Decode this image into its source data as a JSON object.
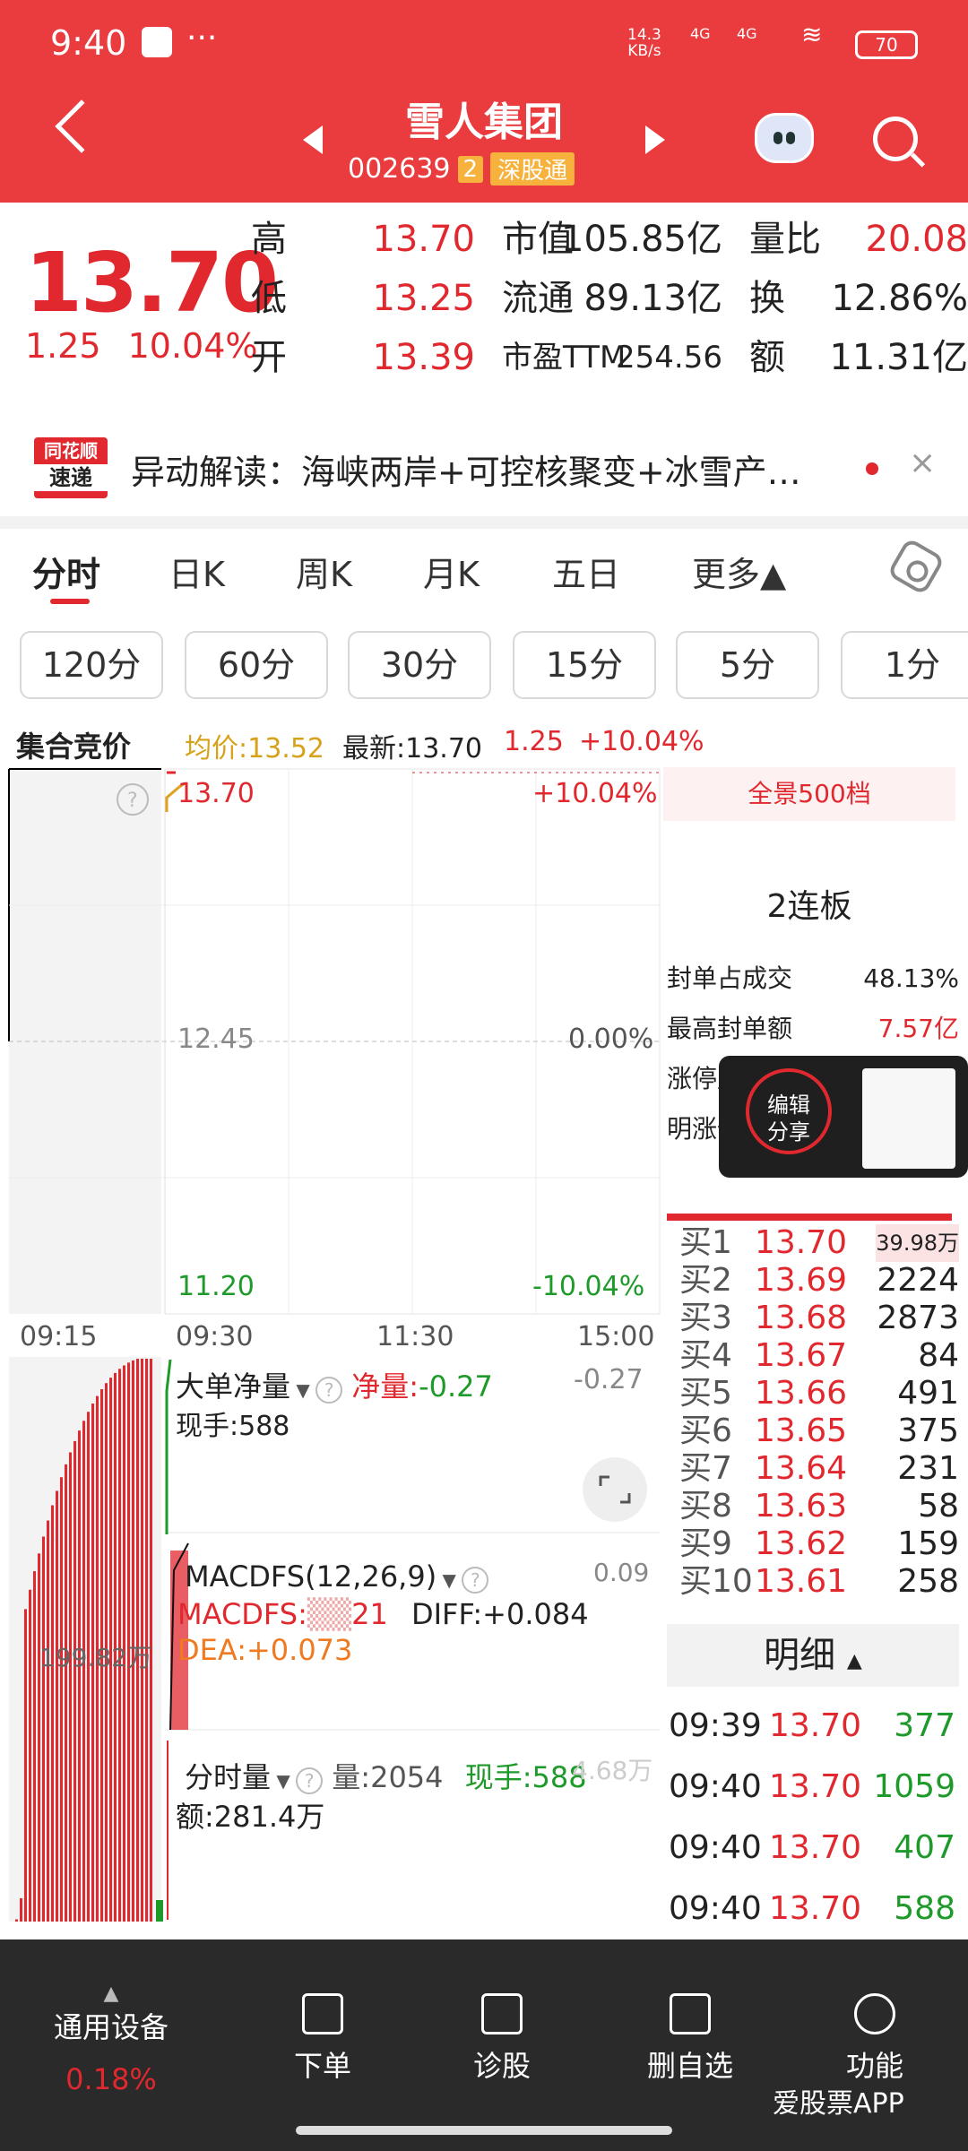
{
  "status": {
    "time": "9:40",
    "dots": "···",
    "netspeed_value": "14.3",
    "netspeed_unit": "KB/s",
    "signal1": "4G",
    "signal2": "4G",
    "battery": "70"
  },
  "header": {
    "title": "雪人集团",
    "code": "002639",
    "badge": "2",
    "market": "深股通"
  },
  "quote": {
    "price": "13.70",
    "change": "1.25",
    "change_pct": "10.04%",
    "col1": [
      {
        "label": "高",
        "value": "13.70"
      },
      {
        "label": "低",
        "value": "13.25"
      },
      {
        "label": "开",
        "value": "13.39"
      }
    ],
    "col2": [
      {
        "label": "市值",
        "value": "105.85亿"
      },
      {
        "label": "流通",
        "value": "89.13亿"
      },
      {
        "label": "市盈TTM",
        "value": "254.56"
      }
    ],
    "col3": [
      {
        "label": "量比",
        "value": "20.08"
      },
      {
        "label": "换",
        "value": "12.86%"
      },
      {
        "label": "额",
        "value": "11.31亿"
      }
    ]
  },
  "news": {
    "logo_top": "同花顺",
    "logo_bottom": "速递",
    "text": "异动解读：海峡两岸+可控核聚变+冰雪产…",
    "close": "×"
  },
  "tabs": [
    "分时",
    "日K",
    "周K",
    "月K",
    "五日",
    "更多▲"
  ],
  "periods": [
    "120分",
    "60分",
    "30分",
    "15分",
    "5分",
    "1分"
  ],
  "chartinfo": {
    "auction": "集合竞价",
    "avg": "均价:13.52",
    "latest": "最新:13.70",
    "chg": "1.25",
    "pct": "+10.04%"
  },
  "chart": {
    "high_price": "13.70",
    "mid_price": "12.45",
    "low_price": "11.20",
    "high_pct": "+10.04%",
    "mid_pct": "0.00%",
    "low_pct": "-10.04%",
    "times": [
      "09:15",
      "09:30",
      "11:30",
      "15:00"
    ],
    "auction_vol": "199.82万",
    "bigorder": {
      "title": "大单净量",
      "net_label": "净量:",
      "net_value": "-0.27",
      "right": "-0.27",
      "hand": "现手:588"
    },
    "macd": {
      "title": "MACDFS(12,26,9)",
      "right": "0.09",
      "macd": "MACDFS:",
      "macd_tail": "21",
      "diff": "DIFF:+0.084",
      "dea": "DEA:+0.073"
    },
    "vol": {
      "title": "分时量",
      "vol": "量:2054",
      "hand": "现手:588",
      "right_faded": "4.68万",
      "amount": "额:281.4万"
    }
  },
  "side": {
    "title": "全景500档",
    "board": "2连板",
    "rows": [
      {
        "label": "封单占成交",
        "value": "48.13%"
      },
      {
        "label": "最高封单额",
        "value": "7.57亿"
      },
      {
        "label": "涨停成交额",
        "value": ""
      },
      {
        "label": "明涨停概率",
        "value": ""
      }
    ],
    "bids": [
      {
        "label": "买1",
        "price": "13.70",
        "vol": "39.98万"
      },
      {
        "label": "买2",
        "price": "13.69",
        "vol": "2224"
      },
      {
        "label": "买3",
        "price": "13.68",
        "vol": "2873"
      },
      {
        "label": "买4",
        "price": "13.67",
        "vol": "84"
      },
      {
        "label": "买5",
        "price": "13.66",
        "vol": "491"
      },
      {
        "label": "买6",
        "price": "13.65",
        "vol": "375"
      },
      {
        "label": "买7",
        "price": "13.64",
        "vol": "231"
      },
      {
        "label": "买8",
        "price": "13.63",
        "vol": "58"
      },
      {
        "label": "买9",
        "price": "13.62",
        "vol": "159"
      },
      {
        "label": "买10",
        "price": "13.61",
        "vol": "258"
      }
    ],
    "detail_title": "明细",
    "ticks": [
      {
        "time": "09:39",
        "price": "13.70",
        "vol": "377"
      },
      {
        "time": "09:40",
        "price": "13.70",
        "vol": "1059"
      },
      {
        "time": "09:40",
        "price": "13.70",
        "vol": "407"
      },
      {
        "time": "09:40",
        "price": "13.70",
        "vol": "588"
      }
    ]
  },
  "overlay": {
    "line1": "编辑",
    "line2": "分享"
  },
  "nav": [
    {
      "label": "通用设备",
      "sub": "0.18%"
    },
    {
      "label": "下单"
    },
    {
      "label": "诊股"
    },
    {
      "label": "删自选"
    },
    {
      "label": "功能"
    }
  ],
  "watermark": "爱股票APP"
}
